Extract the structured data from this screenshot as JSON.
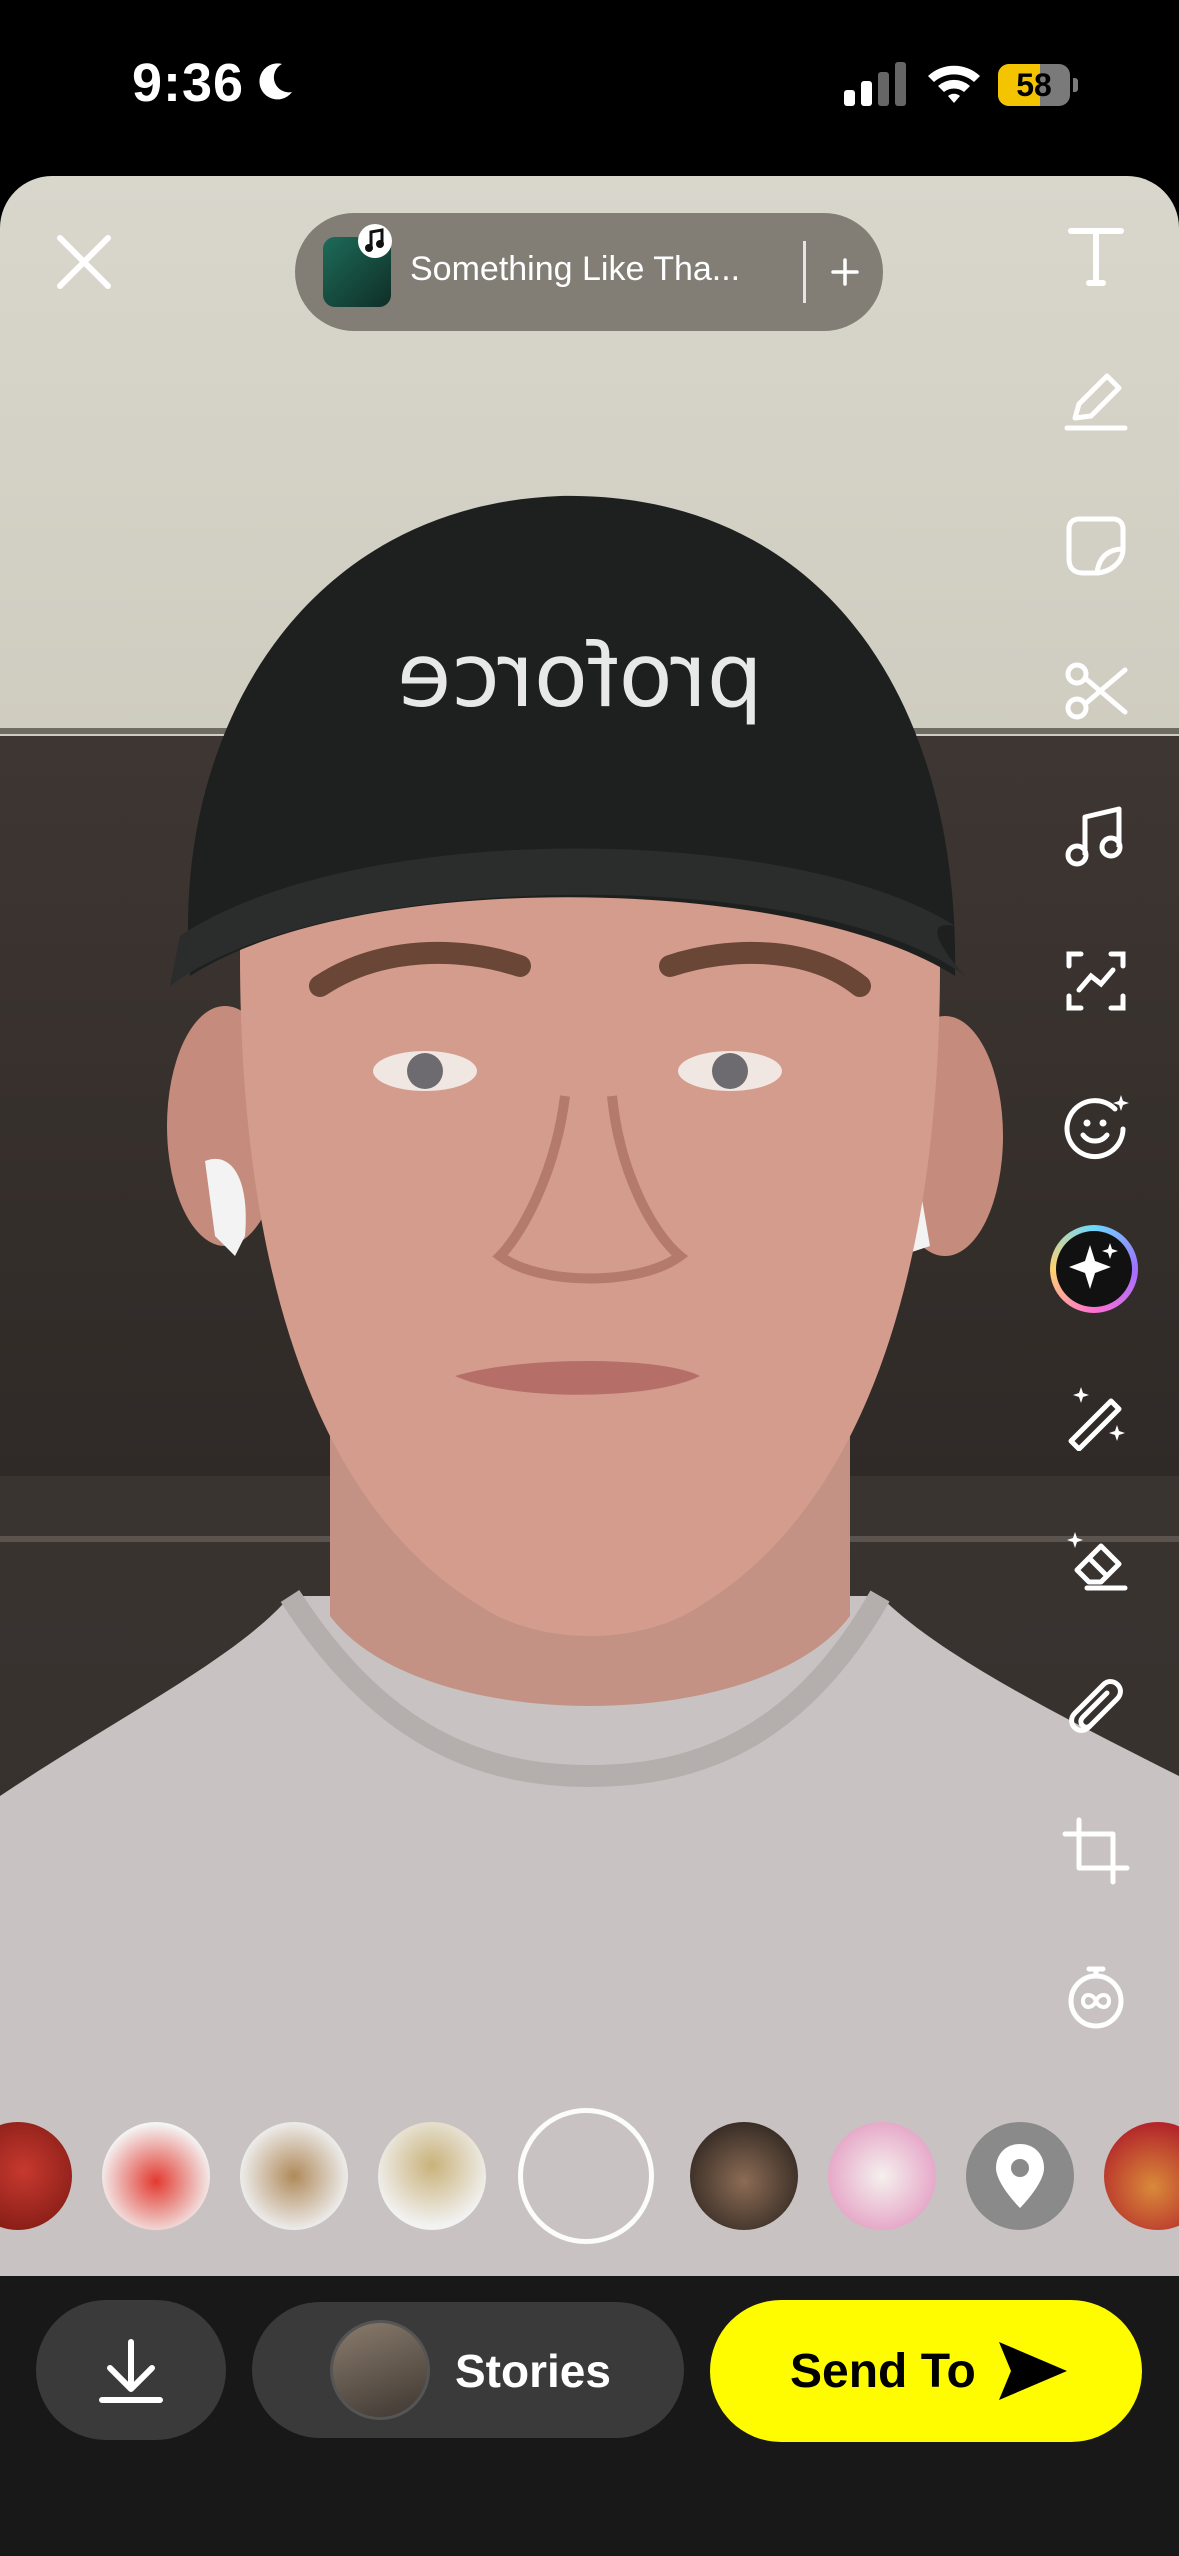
{
  "status_bar": {
    "time": "9:36",
    "battery_level": "58",
    "battery_percent": 58,
    "battery_color": "#f5c400"
  },
  "music": {
    "title": "Something Like Tha...",
    "add_symbol": "+"
  },
  "tools": [
    {
      "name": "text-tool",
      "icon": "text-icon"
    },
    {
      "name": "draw-tool",
      "icon": "pencil-icon"
    },
    {
      "name": "sticker-tool",
      "icon": "sticker-icon"
    },
    {
      "name": "scissors-tool",
      "icon": "scissors-icon"
    },
    {
      "name": "music-tool",
      "icon": "music-note-icon"
    },
    {
      "name": "lens-scan-tool",
      "icon": "scan-icon"
    },
    {
      "name": "face-lens-tool",
      "icon": "face-sparkle-icon"
    },
    {
      "name": "ai-tool",
      "icon": "sparkles-icon"
    },
    {
      "name": "magic-wand-tool",
      "icon": "magic-wand-icon"
    },
    {
      "name": "eraser-tool",
      "icon": "magic-eraser-icon"
    },
    {
      "name": "attach-link-tool",
      "icon": "paperclip-icon"
    },
    {
      "name": "crop-tool",
      "icon": "crop-icon"
    },
    {
      "name": "timer-tool",
      "icon": "loop-timer-icon"
    }
  ],
  "lenses": [
    {
      "name": "spider-hero-lens",
      "color": "#b8322a"
    },
    {
      "name": "red-character-lens",
      "color": "#d42b23"
    },
    {
      "name": "capybara-lens",
      "color": "#b08a5a"
    },
    {
      "name": "sage-hat-lens",
      "color": "#c9b27a"
    },
    {
      "name": "kitten-lens",
      "color": "#6b5443"
    },
    {
      "name": "cat-tongue-lens",
      "color": "#e6a8c8"
    },
    {
      "name": "location-lens",
      "color": "#8a8a8a"
    },
    {
      "name": "waffle-lens",
      "color": "#d46a2a"
    }
  ],
  "bottom_bar": {
    "stories_label": "Stories",
    "send_label": "Send To",
    "send_color": "#fffc00"
  }
}
